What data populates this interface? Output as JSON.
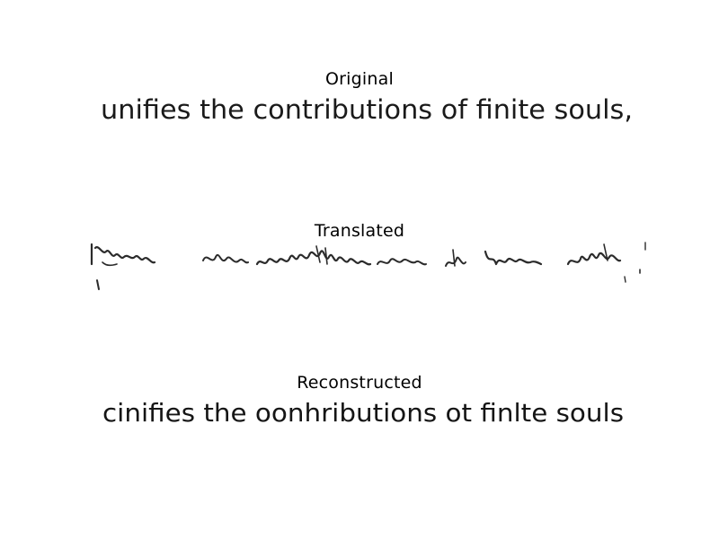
{
  "panels": [
    {
      "title": "Original",
      "text": "unifies the contributions of finite souls,"
    },
    {
      "title": "Translated"
    },
    {
      "title": "Reconstructed",
      "text": "cinifies the oonhributions ot finlte souls"
    }
  ],
  "colors": {
    "background": "#ffffff",
    "ink": "#1a1a1a",
    "title": "#000000"
  }
}
